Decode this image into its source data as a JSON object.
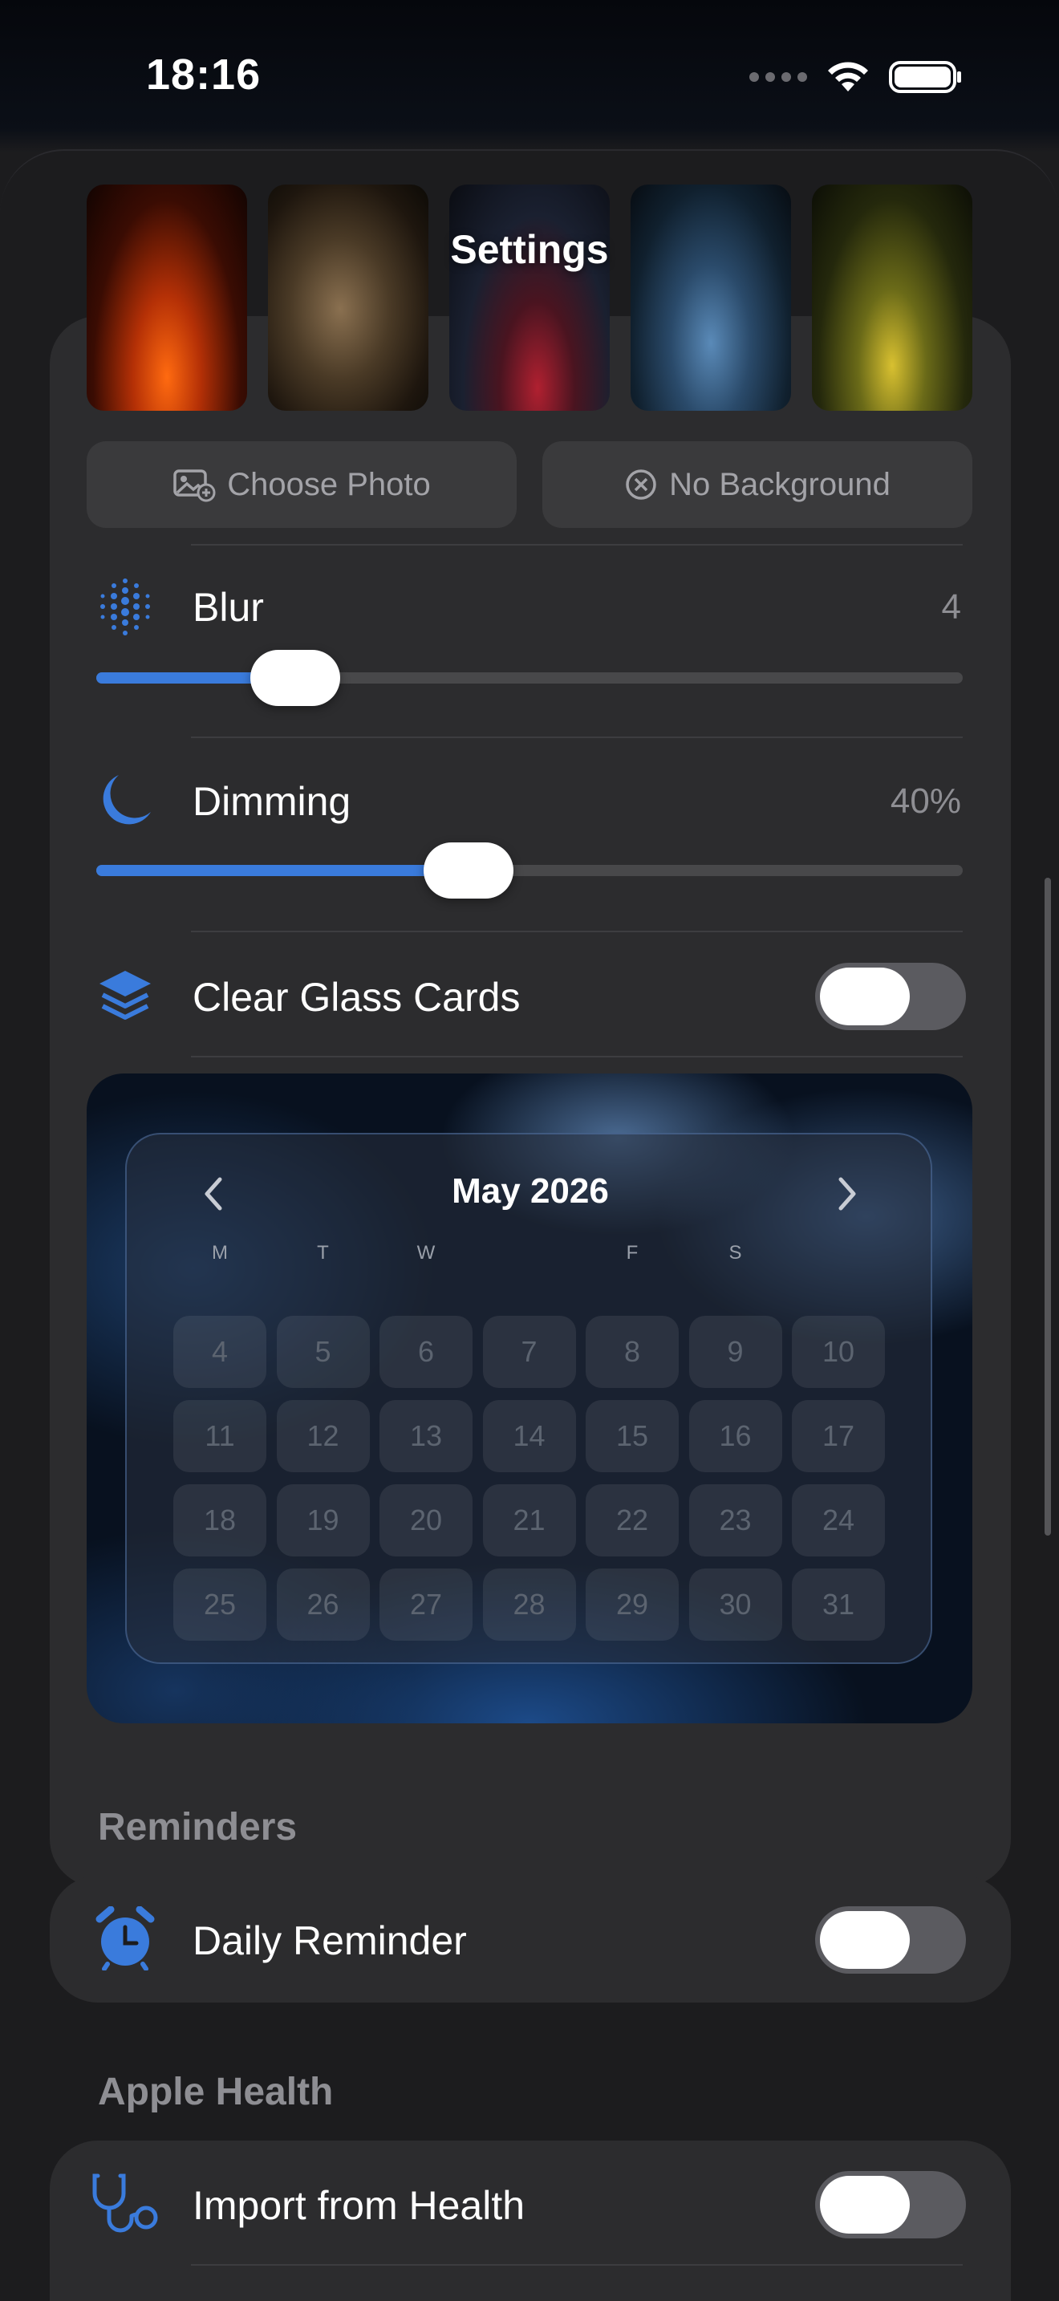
{
  "status_bar": {
    "time": "18:16"
  },
  "sheet": {
    "title": "Settings"
  },
  "background_thumbnails": [
    {
      "name": "fire-figure-thumb"
    },
    {
      "name": "dust-figure-thumb"
    },
    {
      "name": "red-splash-thumb"
    },
    {
      "name": "blue-figure-thumb"
    },
    {
      "name": "yellow-burst-thumb"
    }
  ],
  "actions": {
    "choose_photo": "Choose Photo",
    "no_background": "No Background"
  },
  "blur": {
    "label": "Blur",
    "value": "4",
    "fraction": 0.23
  },
  "dimming": {
    "label": "Dimming",
    "value": "40%",
    "fraction": 0.43
  },
  "clear_glass": {
    "label": "Clear Glass Cards",
    "enabled": false
  },
  "preview_calendar": {
    "title": "May 2026",
    "weekdays": [
      "M",
      "T",
      "W",
      "",
      "F",
      "S",
      ""
    ],
    "days": [
      "4",
      "5",
      "6",
      "7",
      "8",
      "9",
      "10",
      "11",
      "12",
      "13",
      "14",
      "15",
      "16",
      "17",
      "18",
      "19",
      "20",
      "21",
      "22",
      "23",
      "24",
      "25",
      "26",
      "27",
      "28",
      "29",
      "30",
      "31"
    ]
  },
  "reminders": {
    "header": "Reminders",
    "daily_reminder": {
      "label": "Daily Reminder",
      "enabled": false
    }
  },
  "apple_health": {
    "header": "Apple Health",
    "import": {
      "label": "Import from Health",
      "enabled": false
    }
  },
  "colors": {
    "accent": "#3a7bdc",
    "background": "#1c1c1e",
    "card": "#2c2c2e",
    "toggle_off": "#5b5b60"
  }
}
